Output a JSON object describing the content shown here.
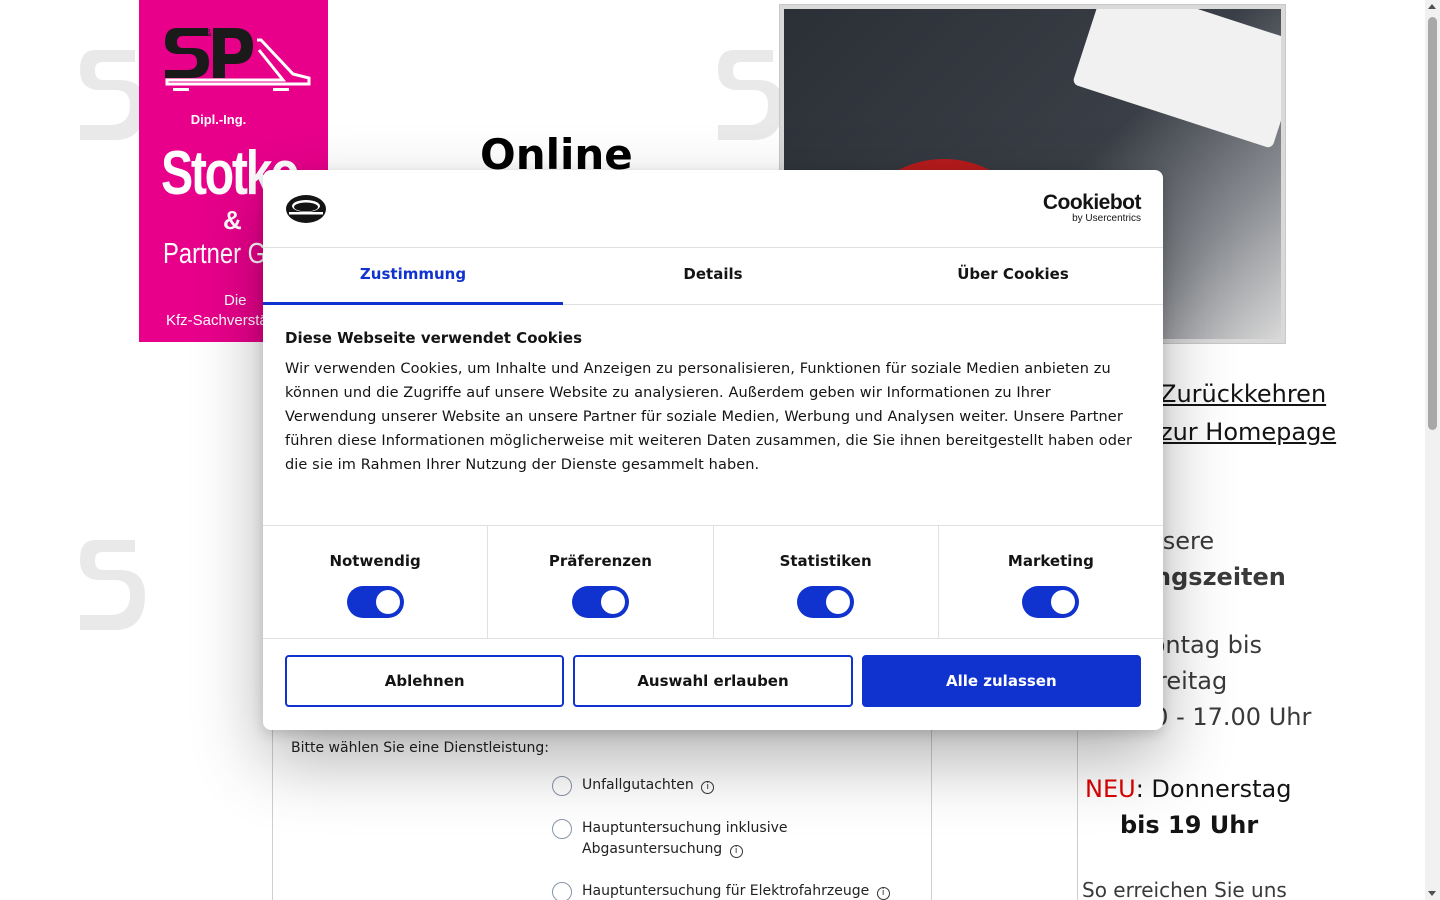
{
  "logo": {
    "monogram": "S&P",
    "title_prefix": "Dipl.-Ing.",
    "name": "Stotko",
    "ampersand": "&",
    "partner": "Partner GmbH",
    "tagline_1": "Die",
    "tagline_2": "Kfz-Sachverständigen"
  },
  "page": {
    "heading": "Online"
  },
  "right_column": {
    "back_link_line1": "Zurückkehren",
    "back_link_line2": "zur Homepage",
    "hours_intro_line1": "Unsere",
    "hours_intro_line2": "Öffnungszeiten",
    "days_line1": "Montag bis",
    "days_line2": "Freitag",
    "time": "8.00 - 17.00 Uhr",
    "neu_label": "NEU",
    "neu_text": ": Donnerstag",
    "neu_time": "bis 19 Uhr",
    "contact": "So erreichen Sie uns"
  },
  "form": {
    "label": "Bitte wählen Sie eine Dienstleistung:",
    "options": [
      {
        "label": "Unfallgutachten"
      },
      {
        "label": "Hauptuntersuchung inklusive Abgasuntersuchung"
      },
      {
        "label": "Hauptuntersuchung für Elektrofahrzeuge"
      }
    ],
    "info_glyph": "i"
  },
  "cookie_dialog": {
    "brand_name": "Cookiebot",
    "brand_sub": "by Usercentrics",
    "tabs": [
      {
        "label": "Zustimmung",
        "active": true
      },
      {
        "label": "Details",
        "active": false
      },
      {
        "label": "Über Cookies",
        "active": false
      }
    ],
    "title": "Diese Webseite verwendet Cookies",
    "body": "Wir verwenden Cookies, um Inhalte und Anzeigen zu personalisieren, Funktionen für soziale Medien anbieten zu können und die Zugriffe auf unsere Website zu analysieren. Außerdem geben wir Informationen zu Ihrer Verwendung unserer Website an unsere Partner für soziale Medien, Werbung und Analysen weiter. Unsere Partner führen diese Informationen möglicherweise mit weiteren Daten zusammen, die Sie ihnen bereitgestellt haben oder die sie im Rahmen Ihrer Nutzung der Dienste gesammelt haben.",
    "categories": [
      {
        "label": "Notwendig",
        "enabled": true
      },
      {
        "label": "Präferenzen",
        "enabled": true
      },
      {
        "label": "Statistiken",
        "enabled": true
      },
      {
        "label": "Marketing",
        "enabled": true
      }
    ],
    "buttons": {
      "decline": "Ablehnen",
      "allow_selection": "Auswahl erlauben",
      "allow_all": "Alle zulassen"
    }
  },
  "colors": {
    "brand_pink": "#e8008b",
    "accent_blue": "#1032cf",
    "neu_red": "#e00000"
  }
}
